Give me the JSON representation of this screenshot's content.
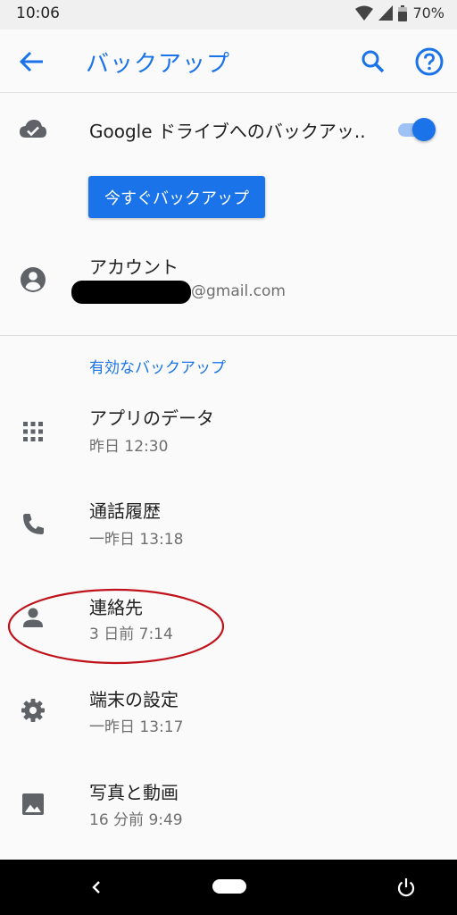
{
  "status_bar": {
    "time": "10:06",
    "battery": "70%"
  },
  "app_bar": {
    "title": "バックアップ"
  },
  "drive_backup": {
    "label": "Google ドライブへのバックアッ..",
    "toggle_on": true,
    "button_label": "今すぐバックアップ"
  },
  "account": {
    "title": "アカウント",
    "email_domain": "@gmail.com"
  },
  "section_header": "有効なバックアップ",
  "backups": [
    {
      "title": "アプリのデータ",
      "time": "昨日 12:30",
      "icon": "apps-grid-icon"
    },
    {
      "title": "通話履歴",
      "time": "一昨日 13:18",
      "icon": "phone-icon"
    },
    {
      "title": "連絡先",
      "time": "3 日前 7:14",
      "icon": "person-icon"
    },
    {
      "title": "端末の設定",
      "time": "一昨日 13:17",
      "icon": "gear-icon"
    },
    {
      "title": "写真と動画",
      "time": "16 分前 9:49",
      "icon": "image-icon"
    }
  ],
  "colors": {
    "accent": "#1a73e8",
    "annotation_ring": "#c0121a",
    "background": "#fafafa"
  }
}
